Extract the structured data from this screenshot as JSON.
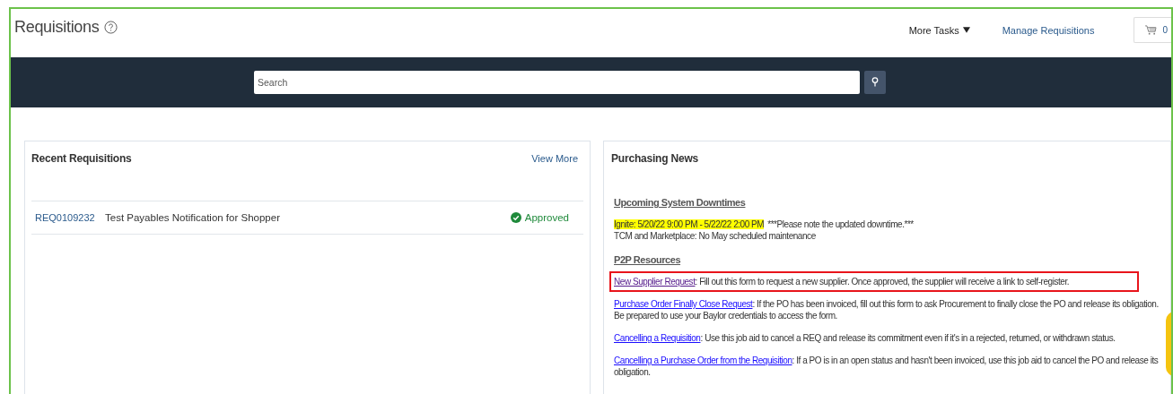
{
  "header": {
    "title": "Requisitions",
    "actions": [
      {
        "kind": "menu",
        "label": "More Tasks"
      },
      {
        "kind": "link",
        "label": "Manage Requisitions"
      }
    ],
    "cart": {
      "count": "0"
    }
  },
  "search": {
    "placeholder": "Search"
  },
  "recent_requisitions": {
    "title": "Recent Requisitions",
    "view_more": "View More",
    "rows": [
      {
        "number": "REQ0109232",
        "description": "Test Payables Notification for Shopper",
        "status": "Approved"
      }
    ]
  },
  "purchasing_news": {
    "title": "Purchasing News",
    "sections": [
      {
        "heading": "Upcoming System Downtimes",
        "kind": "notices",
        "lines": [
          {
            "highlight": "Ignite: 5/20/22 9:00 PM - 5/22/22 2:00 PM",
            "text": "***Please note the updated downtime.***"
          },
          {
            "text": "TCM and Marketplace: No May scheduled maintenance"
          }
        ]
      },
      {
        "heading": "P2P Resources",
        "kind": "resources",
        "items": [
          {
            "link": "New Supplier Request",
            "visited": true,
            "outlined": true,
            "text": ": Fill out this form to request a new supplier. Once approved, the supplier will receive a link to self-register."
          },
          {
            "link": "Purchase Order Finally Close Request",
            "visited": false,
            "outlined": false,
            "text": ": If the PO has been invoiced, fill out this form to ask Procurement to finally close the PO and release its obligation. Be prepared to use your Baylor credentials to access the form."
          },
          {
            "link": "Cancelling a Requisition",
            "visited": false,
            "outlined": false,
            "text": ": Use this job aid to cancel a REQ and release its commitment even if it's in a rejected, returned, or withdrawn status."
          },
          {
            "link": "Cancelling a Purchase Order from the Requisition",
            "visited": false,
            "outlined": false,
            "text": ": If a PO is in an open status and hasn't been invoiced, use this job aid to cancel the PO and release its obligation."
          }
        ]
      }
    ]
  }
}
